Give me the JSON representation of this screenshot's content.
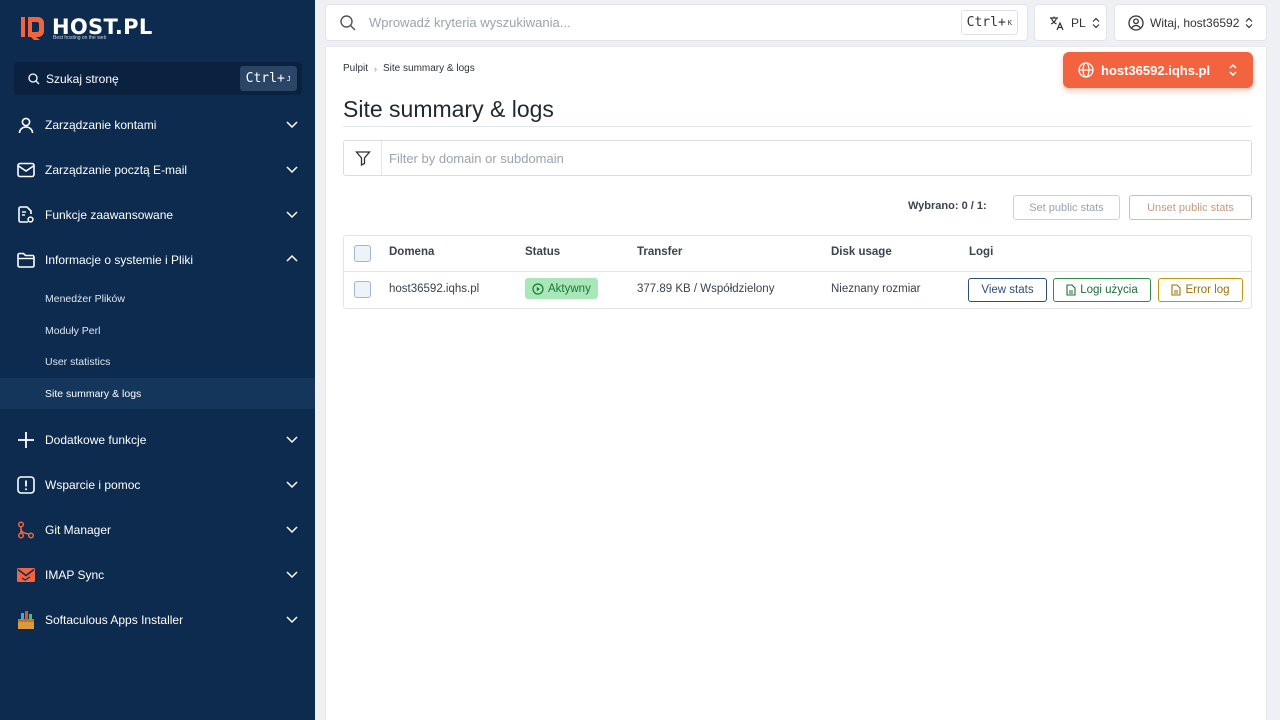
{
  "brand": {
    "logo_text": "HOST.PL",
    "tagline": "Best hosting on the web",
    "accent": "#f26440",
    "sidebar_bg": "#0d2b4e"
  },
  "sidebar": {
    "search_label": "Szukaj stronę",
    "search_shortcut": "Ctrl+",
    "search_shortcut_key": "J",
    "items": [
      {
        "label": "Zarządzanie kontami",
        "icon": "user-icon"
      },
      {
        "label": "Zarządzanie pocztą E-mail",
        "icon": "mail-icon"
      },
      {
        "label": "Funkcje zaawansowane",
        "icon": "gear-document-icon"
      },
      {
        "label": "Informacje o systemie i Pliki",
        "icon": "folder-icon"
      },
      {
        "label": "Dodatkowe funkcje",
        "icon": "plus-icon"
      },
      {
        "label": "Wsparcie i pomoc",
        "icon": "alert-icon"
      },
      {
        "label": "Git Manager",
        "icon": "git-icon"
      },
      {
        "label": "IMAP Sync",
        "icon": "mail-sync-icon"
      },
      {
        "label": "Softaculous Apps Installer",
        "icon": "softaculous-icon"
      }
    ],
    "subitems": [
      {
        "label": "Menedżer Plików"
      },
      {
        "label": "Moduły Perl"
      },
      {
        "label": "User statistics"
      },
      {
        "label": "Site summary & logs"
      }
    ]
  },
  "topbar": {
    "search_placeholder": "Wprowadź kryteria wyszukiwania...",
    "search_shortcut": "Ctrl+",
    "search_shortcut_key": "K",
    "language": "PL",
    "greeting": "Witaj, host36592"
  },
  "main": {
    "breadcrumb": [
      "Pulpit",
      "Site summary & logs"
    ],
    "domain_selector": "host36592.iqhs.pl",
    "title": "Site summary & logs",
    "filter_placeholder": "Filter by domain or subdomain",
    "selected_text": "Wybrano: 0 / 1:",
    "set_public_stats": "Set public stats",
    "unset_public_stats": "Unset public stats",
    "table": {
      "columns": [
        "Domena",
        "Status",
        "Transfer",
        "Disk usage",
        "Logi"
      ],
      "rows": [
        {
          "domain": "host36592.iqhs.pl",
          "status": "Aktywny",
          "transfer": "377.89 KB / Współdzielony",
          "disk_usage": "Nieznany rozmiar",
          "actions": [
            "View stats",
            "Logi użycia",
            "Error log"
          ]
        }
      ]
    }
  }
}
